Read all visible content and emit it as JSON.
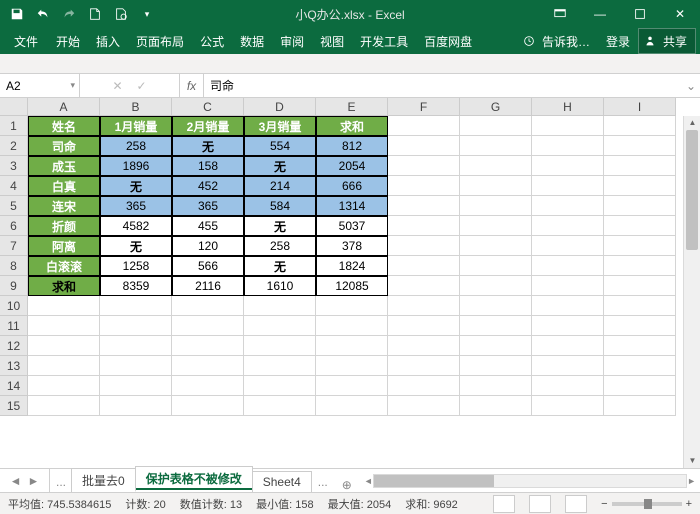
{
  "window": {
    "title": "小Q办公.xlsx - Excel"
  },
  "ribbon": {
    "file": "文件",
    "tabs": [
      "开始",
      "插入",
      "页面布局",
      "公式",
      "数据",
      "审阅",
      "视图",
      "开发工具",
      "百度网盘"
    ],
    "tell_me": "告诉我…",
    "signin": "登录",
    "share": "共享"
  },
  "fx": {
    "cell_ref": "A2",
    "fx_label": "fx",
    "formula": "司命",
    "cancel": "✕",
    "confirm": "✓"
  },
  "columns": [
    "A",
    "B",
    "C",
    "D",
    "E",
    "F",
    "G",
    "H",
    "I"
  ],
  "rows": [
    "1",
    "2",
    "3",
    "4",
    "5",
    "6",
    "7",
    "8",
    "9",
    "10",
    "11",
    "12",
    "13",
    "14",
    "15"
  ],
  "table": {
    "headers": [
      "姓名",
      "1月销量",
      "2月销量",
      "3月销量",
      "求和"
    ],
    "data": [
      {
        "name": "司命",
        "v": [
          "258",
          "无",
          "554",
          "812"
        ],
        "cls": "blue"
      },
      {
        "name": "成玉",
        "v": [
          "1896",
          "158",
          "无",
          "2054"
        ],
        "cls": "blue"
      },
      {
        "name": "白真",
        "v": [
          "无",
          "452",
          "214",
          "666"
        ],
        "cls": "blue"
      },
      {
        "name": "连宋",
        "v": [
          "365",
          "365",
          "584",
          "1314"
        ],
        "cls": "blue"
      },
      {
        "name": "折颜",
        "v": [
          "4582",
          "455",
          "无",
          "5037"
        ],
        "cls": "white"
      },
      {
        "name": "阿离",
        "v": [
          "无",
          "120",
          "258",
          "378"
        ],
        "cls": "white"
      },
      {
        "name": "白滚滚",
        "v": [
          "1258",
          "566",
          "无",
          "1824"
        ],
        "cls": "white"
      }
    ],
    "sum_label": "求和",
    "sum_row": [
      "8359",
      "2116",
      "1610",
      "12085"
    ]
  },
  "sheets": {
    "tabs": [
      "批量去0",
      "保护表格不被修改",
      "Sheet4"
    ],
    "active": 1,
    "ellipsis": "...",
    "add": "⊕"
  },
  "status": {
    "avg_label": "平均值:",
    "avg": "745.5384615",
    "count_label": "计数:",
    "count": "20",
    "numcount_label": "数值计数:",
    "numcount": "13",
    "min_label": "最小值:",
    "min": "158",
    "max_label": "最大值:",
    "max": "2054",
    "sum_label": "求和:",
    "sum": "9692"
  },
  "chart_data": {
    "type": "table",
    "title": "",
    "columns": [
      "姓名",
      "1月销量",
      "2月销量",
      "3月销量",
      "求和"
    ],
    "rows": [
      [
        "司命",
        258,
        null,
        554,
        812
      ],
      [
        "成玉",
        1896,
        158,
        null,
        2054
      ],
      [
        "白真",
        null,
        452,
        214,
        666
      ],
      [
        "连宋",
        365,
        365,
        584,
        1314
      ],
      [
        "折颜",
        4582,
        455,
        null,
        5037
      ],
      [
        "阿离",
        null,
        120,
        258,
        378
      ],
      [
        "白滚滚",
        1258,
        566,
        null,
        1824
      ],
      [
        "求和",
        8359,
        2116,
        1610,
        12085
      ]
    ],
    "null_display": "无"
  }
}
